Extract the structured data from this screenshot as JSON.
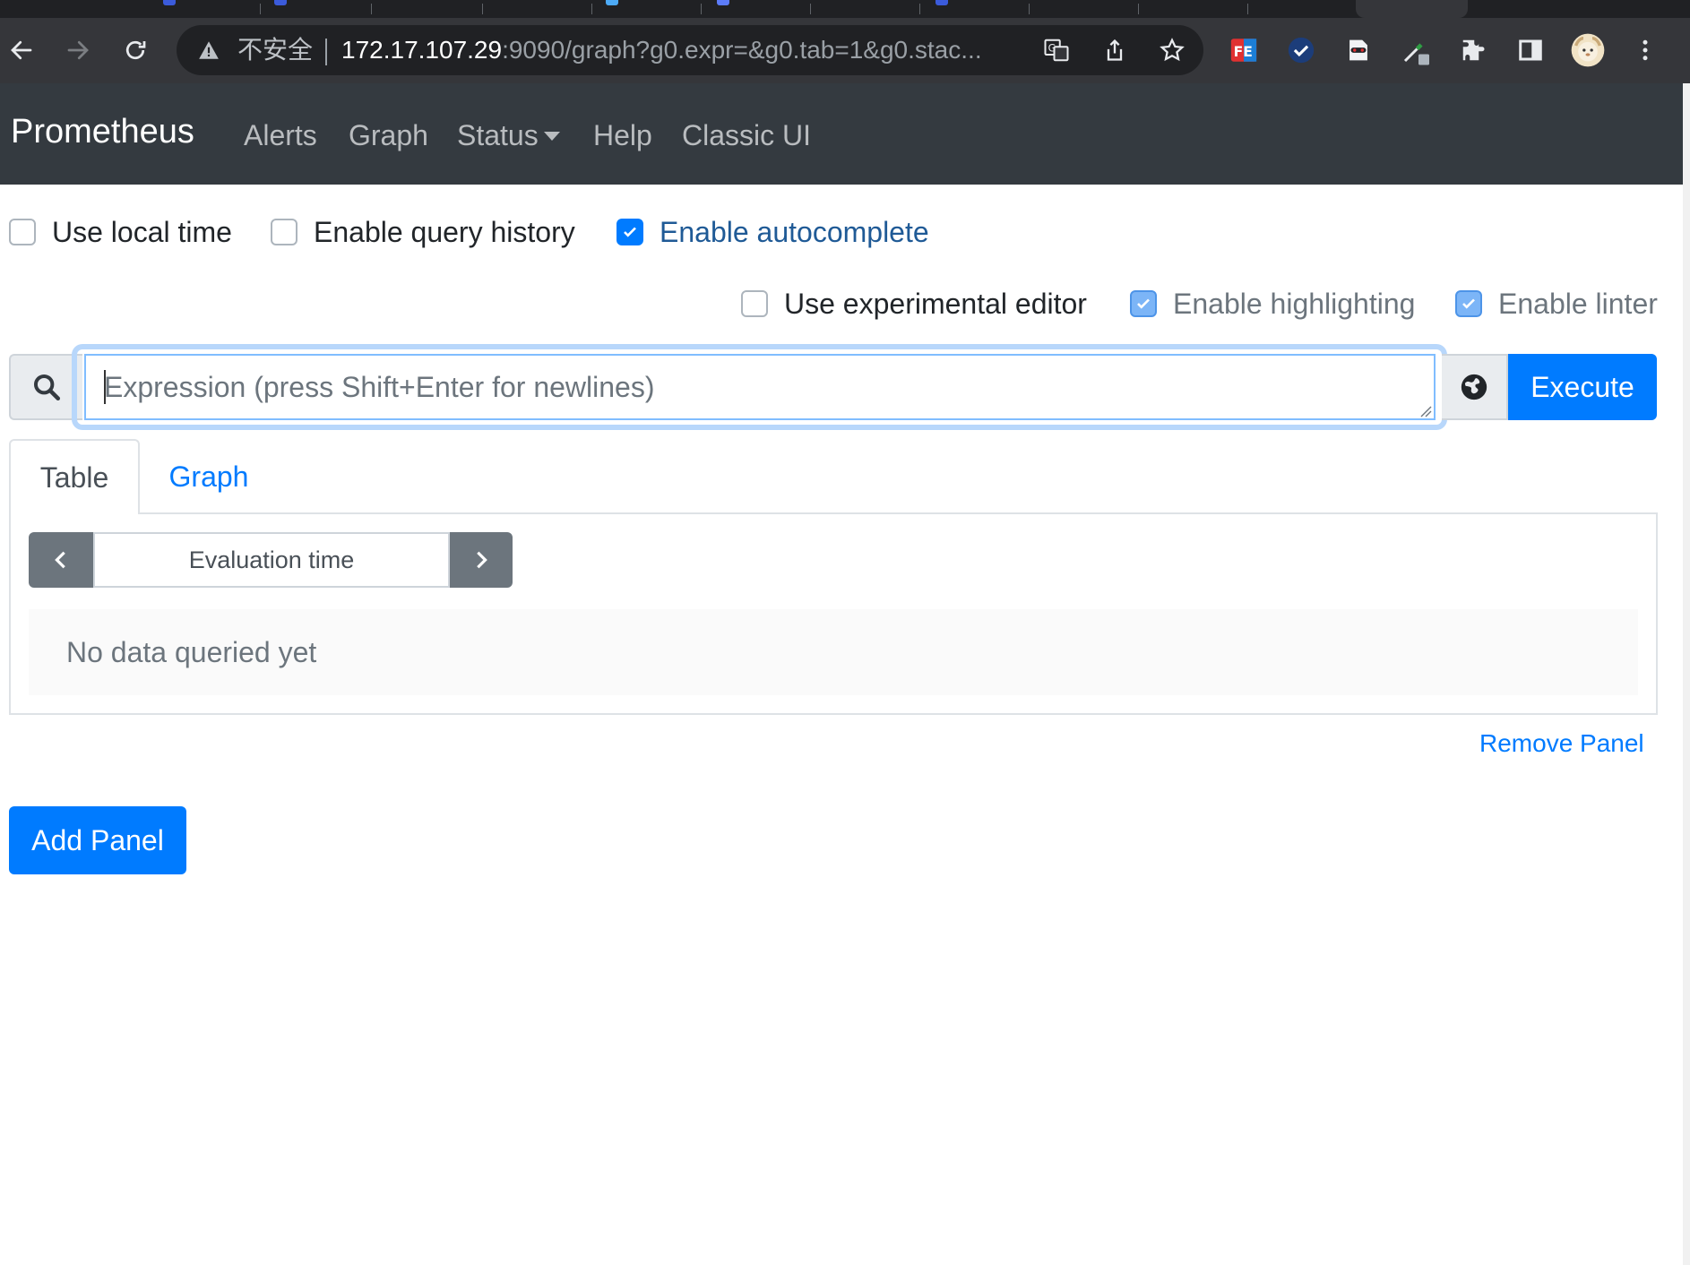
{
  "browser": {
    "url_insecure_label": "不安全",
    "url_host": "172.17.107.29",
    "url_rest": ":9090/graph?g0.expr=&g0.tab=1&g0.stac...",
    "icons": [
      "back-icon",
      "forward-icon",
      "reload-icon",
      "warning-icon",
      "translate-icon",
      "share-icon",
      "star-icon",
      "extension-fe-icon",
      "extension-check-icon",
      "extension-glasses-icon",
      "extension-eyedropper-icon",
      "puzzle-icon",
      "sidepanel-icon",
      "profile-avatar",
      "kebab-menu-icon"
    ]
  },
  "navbar": {
    "brand": "Prometheus",
    "links": [
      "Alerts",
      "Graph",
      "Status",
      "Help",
      "Classic UI"
    ]
  },
  "options": {
    "use_local_time": {
      "label": "Use local time",
      "checked": false
    },
    "enable_query_history": {
      "label": "Enable query history",
      "checked": false
    },
    "enable_autocomplete": {
      "label": "Enable autocomplete",
      "checked": true
    },
    "use_experimental_editor": {
      "label": "Use experimental editor",
      "checked": false
    },
    "enable_highlighting": {
      "label": "Enable highlighting",
      "checked": true
    },
    "enable_linter": {
      "label": "Enable linter",
      "checked": true
    }
  },
  "expression": {
    "placeholder": "Expression (press Shift+Enter for newlines)",
    "value": "",
    "execute_label": "Execute"
  },
  "panel": {
    "tabs": [
      {
        "label": "Table",
        "active": true
      },
      {
        "label": "Graph",
        "active": false
      }
    ],
    "evaluation_time_placeholder": "Evaluation time",
    "empty_text": "No data queried yet",
    "remove_label": "Remove Panel"
  },
  "add_panel_label": "Add Panel",
  "colors": {
    "accent": "#007bff",
    "navbar": "#343a40",
    "chrome": "#35363a"
  }
}
